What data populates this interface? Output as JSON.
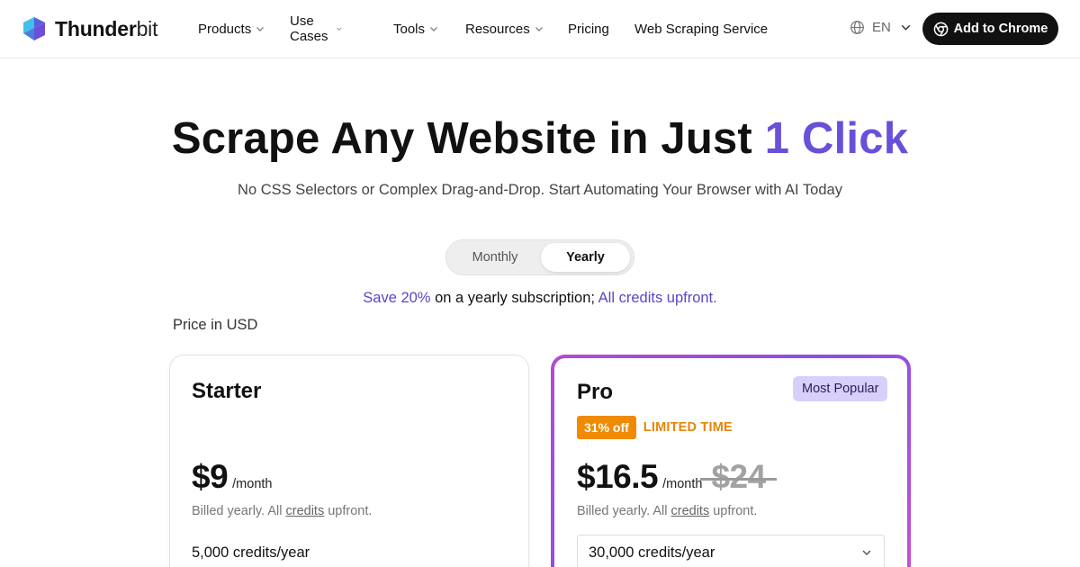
{
  "brand": {
    "name_bold": "Thunder",
    "name_light": "bit"
  },
  "nav": {
    "items": [
      {
        "label": "Products",
        "dropdown": true
      },
      {
        "label": "Use Cases",
        "dropdown": true
      },
      {
        "label": "Tools",
        "dropdown": true
      },
      {
        "label": "Resources",
        "dropdown": true
      },
      {
        "label": "Pricing",
        "dropdown": false
      },
      {
        "label": "Web Scraping Service",
        "dropdown": false
      }
    ],
    "language": "EN",
    "cta_label": "Add to Chrome"
  },
  "hero": {
    "title_main": "Scrape Any Website in Just ",
    "title_accent": "1 Click",
    "subtitle": "No CSS Selectors or Complex Drag-and-Drop. Start Automating Your Browser with AI Today"
  },
  "billing_toggle": {
    "monthly_label": "Monthly",
    "yearly_label": "Yearly",
    "selected": "Yearly"
  },
  "save_line": {
    "highlight": "Save 20%",
    "middle": " on a yearly subscription; ",
    "tail": "All credits upfront."
  },
  "price_note": "Price in USD",
  "plans": {
    "starter": {
      "name": "Starter",
      "price": "$9",
      "period": "/month",
      "billed_prefix": "Billed yearly. All ",
      "billed_link": "credits",
      "billed_suffix": " upfront.",
      "credits": "5,000 credits/year"
    },
    "pro": {
      "name": "Pro",
      "badge": "Most Popular",
      "discount": "31% off",
      "limited": "LIMITED TIME",
      "price": "$16.5",
      "period": "/month",
      "old_price": "$24",
      "billed_prefix": "Billed yearly. All ",
      "billed_link": "credits",
      "billed_suffix": " upfront.",
      "credits_selected": "30,000 credits/year"
    }
  },
  "colors": {
    "accent": "#6a4fd9",
    "discount_orange": "#f08a00",
    "badge_lavender": "#d9cffb",
    "cta_black": "#111111"
  },
  "icons": [
    "thunderbit-logo-icon",
    "chevron-down-icon",
    "globe-icon",
    "chrome-icon"
  ]
}
